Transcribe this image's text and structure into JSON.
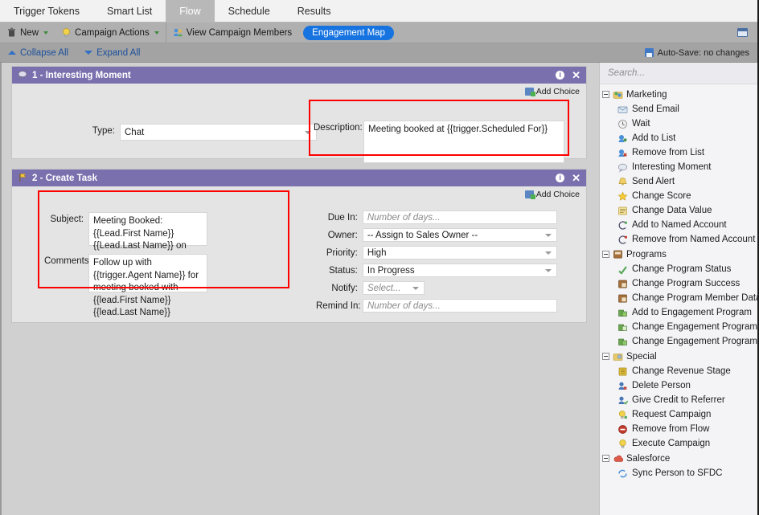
{
  "tabs": [
    {
      "label": "Trigger Tokens",
      "active": false
    },
    {
      "label": "Smart List",
      "active": false
    },
    {
      "label": "Flow",
      "active": true
    },
    {
      "label": "Schedule",
      "active": false
    },
    {
      "label": "Results",
      "active": false
    }
  ],
  "toolbar": {
    "new_label": "New",
    "new_icon": "trash-icon",
    "campaign_actions_label": "Campaign Actions",
    "campaign_actions_icon": "lightbulb-icon",
    "view_members_label": "View Campaign Members",
    "view_members_icon": "people-icon",
    "engagement_map_label": "Engagement Map",
    "window_icon": "restore-window-icon"
  },
  "subtoolbar": {
    "collapse_all": "Collapse All",
    "expand_all": "Expand All",
    "autosave": "Auto-Save: no changes",
    "autosave_icon": "floppy-disk-icon"
  },
  "steps": [
    {
      "title": "1 - Interesting Moment",
      "icon": "speech-bubble-icon",
      "add_choice": "Add Choice",
      "type_label": "Type:",
      "type_value": "Chat",
      "description_label": "Description:",
      "description_value": "Meeting booked at {{trigger.Scheduled For}}"
    },
    {
      "title": "2 - Create Task",
      "icon": "flag-icon",
      "add_choice": "Add Choice",
      "subject_label": "Subject:",
      "subject_value": "Meeting Booked: {{Lead.First Name}} {{Lead.Last Name}} on {{trigger.Scheduled For}}",
      "comments_label": "Comments:",
      "comments_value": "Follow up with {{trigger.Agent Name}} for meeting booked with {{lead.First Name}} {{lead.Last Name}}",
      "fields": [
        {
          "label": "Due In:",
          "value": "Number of days...",
          "placeholder": true,
          "type": "text"
        },
        {
          "label": "Owner:",
          "value": "-- Assign to Sales Owner --",
          "placeholder": false,
          "type": "select"
        },
        {
          "label": "Priority:",
          "value": "High",
          "placeholder": false,
          "type": "select"
        },
        {
          "label": "Status:",
          "value": "In Progress",
          "placeholder": false,
          "type": "select"
        },
        {
          "label": "Notify:",
          "value": "Select...",
          "placeholder": true,
          "type": "select-small"
        },
        {
          "label": "Remind In:",
          "value": "Number of days...",
          "placeholder": true,
          "type": "text"
        }
      ]
    }
  ],
  "palette": {
    "search_placeholder": "Search...",
    "groups": [
      {
        "label": "Marketing",
        "icon": "marketing-folder-icon",
        "items": [
          {
            "label": "Send Email",
            "icon": "email-icon",
            "color": "#9fbcd8"
          },
          {
            "label": "Wait",
            "icon": "clock-icon",
            "color": "#d6d6d6"
          },
          {
            "label": "Add to List",
            "icon": "list-add-icon",
            "color": "#7faf5a"
          },
          {
            "label": "Remove from List",
            "icon": "list-remove-icon",
            "color": "#c0504d"
          },
          {
            "label": "Interesting Moment",
            "icon": "speech-bubble-icon",
            "color": "#b9c6d6"
          },
          {
            "label": "Send Alert",
            "icon": "alert-bell-icon",
            "color": "#e0b94a"
          },
          {
            "label": "Change Score",
            "icon": "star-icon",
            "color": "#f2c game"
          },
          {
            "label": "Change Data Value",
            "icon": "data-value-icon",
            "color": "#e3c96b"
          },
          {
            "label": "Add to Named Account",
            "icon": "named-account-add-icon",
            "color": "#5a9f5a"
          },
          {
            "label": "Remove from Named Account",
            "icon": "named-account-remove-icon",
            "color": "#c0504d"
          }
        ]
      },
      {
        "label": "Programs",
        "icon": "programs-folder-icon",
        "items": [
          {
            "label": "Change Program Status",
            "icon": "program-status-icon",
            "color": "#5aa85a"
          },
          {
            "label": "Change Program Success",
            "icon": "program-success-icon",
            "color": "#9a6b3f"
          },
          {
            "label": "Change Program Member Data",
            "icon": "program-member-data-icon",
            "color": "#9a6b3f"
          },
          {
            "label": "Add to Engagement Program",
            "icon": "engagement-add-icon",
            "color": "#6aa84f"
          },
          {
            "label": "Change Engagement Program Cadence",
            "icon": "engagement-cadence-icon",
            "color": "#6aa84f"
          },
          {
            "label": "Change Engagement Program Stream",
            "icon": "engagement-stream-icon",
            "color": "#6aa84f"
          }
        ]
      },
      {
        "label": "Special",
        "icon": "special-folder-icon",
        "items": [
          {
            "label": "Change Revenue Stage",
            "icon": "revenue-stage-icon",
            "color": "#d4b43c"
          },
          {
            "label": "Delete Person",
            "icon": "person-delete-icon",
            "color": "#4a78b5"
          },
          {
            "label": "Give Credit to Referrer",
            "icon": "referrer-icon",
            "color": "#5aa85a"
          },
          {
            "label": "Request Campaign",
            "icon": "request-campaign-icon",
            "color": "#e0cf5a"
          },
          {
            "label": "Remove from Flow",
            "icon": "remove-flow-icon",
            "color": "#c0392b"
          },
          {
            "label": "Execute Campaign",
            "icon": "execute-campaign-icon",
            "color": "#e8d24a"
          }
        ]
      },
      {
        "label": "Salesforce",
        "icon": "salesforce-folder-icon",
        "items": [
          {
            "label": "Sync Person to SFDC",
            "icon": "sync-person-icon",
            "color": "#4a90d9"
          }
        ]
      }
    ]
  }
}
